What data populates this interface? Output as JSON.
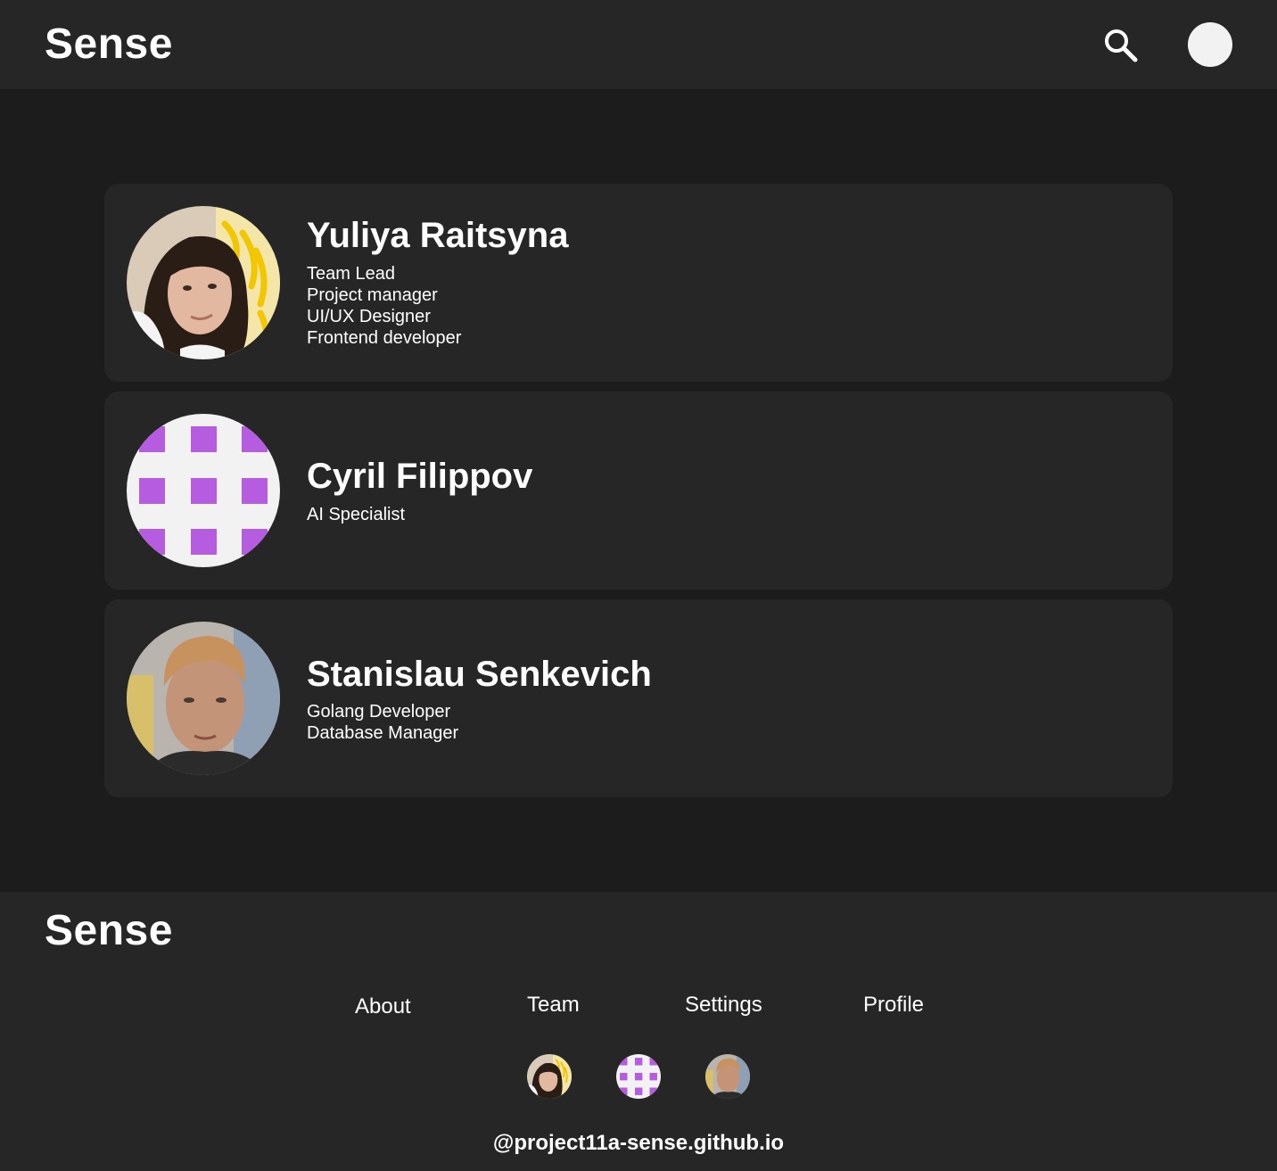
{
  "header": {
    "logo": "Sense",
    "search_icon": "search-icon",
    "avatar_icon": "user-avatar"
  },
  "team": [
    {
      "name": "Yuliya Raitsyna",
      "roles": [
        "Team Lead",
        "Project manager",
        "UI/UX Designer",
        "Frontend developer"
      ]
    },
    {
      "name": "Cyril Filippov",
      "roles": [
        "AI Specialist"
      ]
    },
    {
      "name": "Stanislau Senkevich",
      "roles": [
        "Golang Developer",
        "Database Manager"
      ]
    }
  ],
  "footer": {
    "logo": "Sense",
    "nav": [
      "About",
      "Team",
      "Settings",
      "Profile"
    ],
    "handle": "@project11a-sense.github.io"
  },
  "colors": {
    "header_bg": "#262626",
    "page_bg": "#1c1c1c",
    "card_bg": "#262626",
    "text": "#ffffff",
    "pattern_accent": "#b65ce0",
    "pattern_bg": "#f2f2f2"
  }
}
